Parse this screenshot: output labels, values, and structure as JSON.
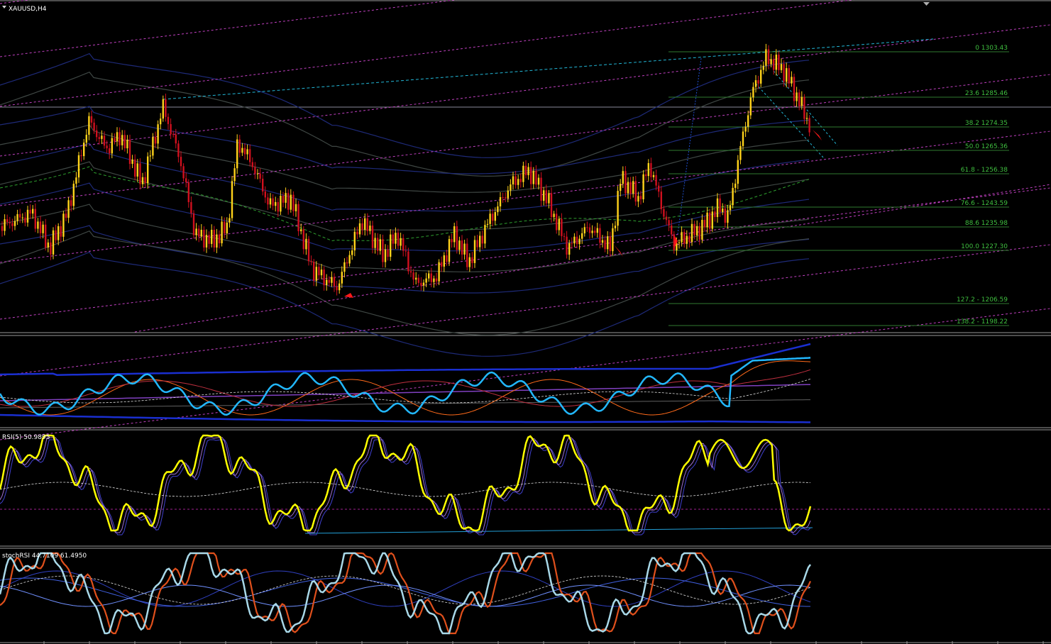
{
  "window": {
    "title": "XAUUSD,H4",
    "collapse_icon": "triangle-down-icon",
    "scroll_marker_icon": "triangle-down-icon"
  },
  "colors": {
    "background": "#000000",
    "separator": "#9a9a9a",
    "bull_candle": "#ffd21a",
    "bear_candle": "#d0101e",
    "channel": "#c040c0",
    "cyan_line": "#22b8d8",
    "fib": "#2f7a2f",
    "fib_text": "#3fbf3f",
    "bands": "#1e2a78",
    "gray_bands": "#3f4744",
    "rsi_line": "#ffff00",
    "stoch_k": "#a8d8e8",
    "stoch_d": "#e0501c",
    "signal_arrow": "#ff1a1a"
  },
  "panes": {
    "rsi": {
      "title": "RSI(5) 50.9895"
    },
    "stoch": {
      "title": "stochRSI 44.7109 61.4950"
    }
  },
  "chart_data": [
    {
      "type": "candlestick",
      "title": "XAUUSD,H4",
      "fibonacci_levels": [
        {
          "label": "0 1303.43"
        },
        {
          "label": "23.6 1285.46"
        },
        {
          "label": "38.2 1274.35"
        },
        {
          "label": "50.0 1265.36"
        },
        {
          "label": "61.8 - 1256.38"
        },
        {
          "label": "76.6 - 1243.59"
        },
        {
          "label": "88.6 1235.98"
        },
        {
          "label": "100.0 1227.30"
        },
        {
          "label": "127.2 - 1206.59"
        },
        {
          "label": "138.2 - 1198.22"
        }
      ]
    },
    {
      "type": "line",
      "title": "RSI(5) 50.9895",
      "last_value": 50.9895
    },
    {
      "type": "line",
      "title": "stochRSI 44.7109 61.4950",
      "values": [
        44.7109,
        61.495
      ]
    }
  ]
}
